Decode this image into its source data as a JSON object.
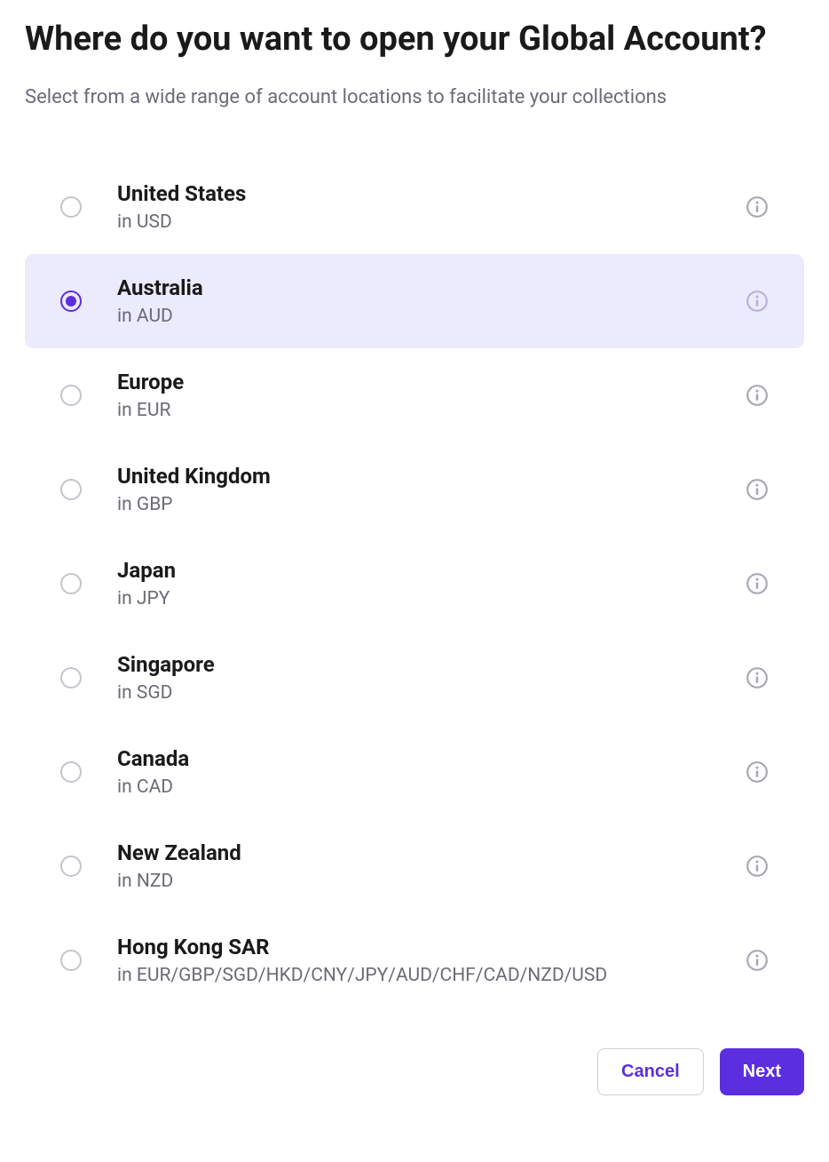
{
  "title": "Where do you want to open your Global Account?",
  "subtitle": "Select from a wide range of account locations to facilitate your collections",
  "options": [
    {
      "name": "United States",
      "currency": "in USD",
      "selected": false
    },
    {
      "name": "Australia",
      "currency": "in AUD",
      "selected": true
    },
    {
      "name": "Europe",
      "currency": "in EUR",
      "selected": false
    },
    {
      "name": "United Kingdom",
      "currency": "in GBP",
      "selected": false
    },
    {
      "name": "Japan",
      "currency": "in JPY",
      "selected": false
    },
    {
      "name": "Singapore",
      "currency": "in SGD",
      "selected": false
    },
    {
      "name": "Canada",
      "currency": "in CAD",
      "selected": false
    },
    {
      "name": "New Zealand",
      "currency": "in NZD",
      "selected": false
    },
    {
      "name": "Hong Kong SAR",
      "currency": "in EUR/GBP/SGD/HKD/CNY/JPY/AUD/CHF/CAD/NZD/USD",
      "selected": false
    }
  ],
  "actions": {
    "cancel_label": "Cancel",
    "next_label": "Next"
  }
}
